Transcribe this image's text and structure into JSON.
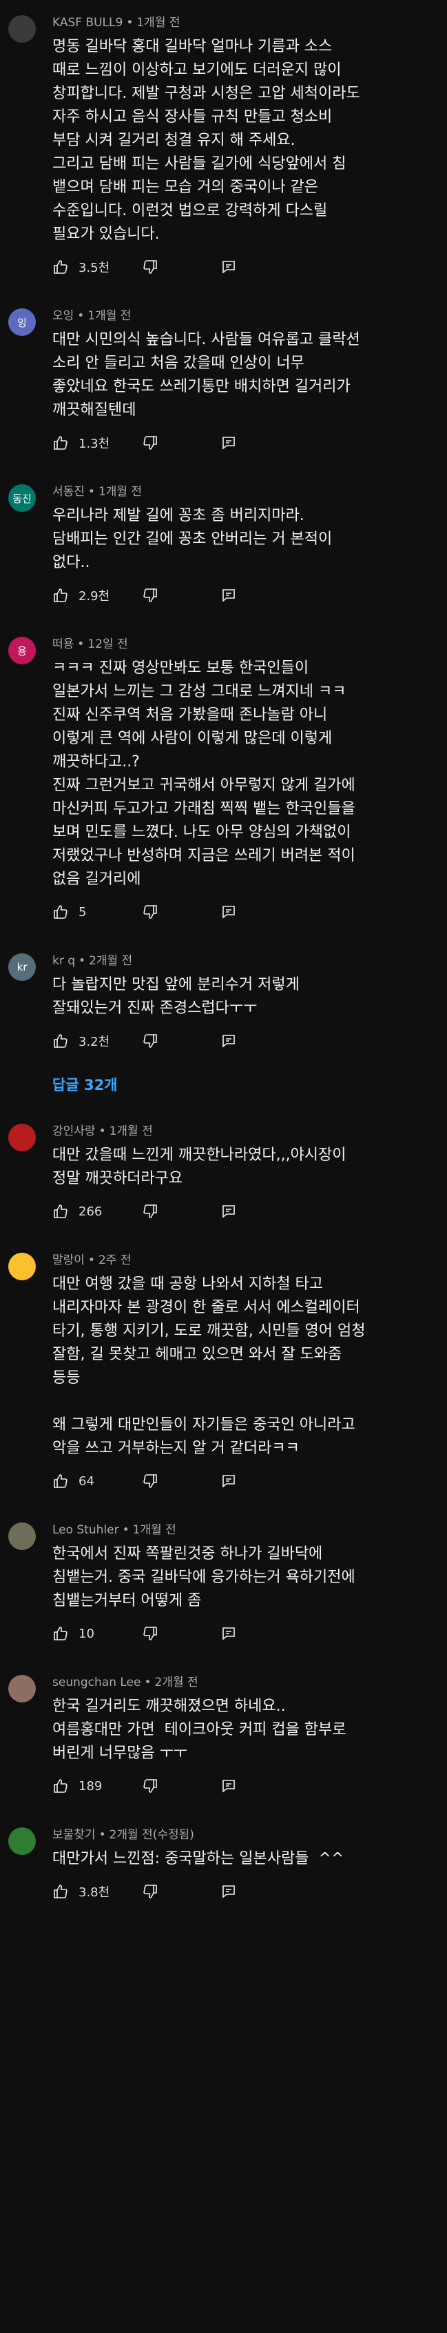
{
  "replies_link": "답글 32개",
  "icons": {
    "like": "thumbs-up-icon",
    "dislike": "thumbs-down-icon",
    "reply": "reply-icon"
  },
  "comments": [
    {
      "author": "KASF BULL9",
      "time": "1개월 전",
      "avatar_text": "",
      "avatar_color": "#3a3a3a",
      "text": "명동 길바닥 홍대 길바닥 얼마나 기름과 소스\n때로 느낌이 이상하고 보기에도 더러운지 많이\n창피합니다. 제발 구청과 시청은 고압 세척이라도\n자주 하시고 음식 장사들 규칙 만들고 청소비\n부담 시켜 길거리 청결 유지 해 주세요.\n그리고 담배 피는 사람들 길가에 식당앞에서 침\n뱉으며 담배 피는 모습 거의 중국이나 같은\n수준입니다. 이런것 법으로 강력하게 다스릴\n필요가 있습니다.",
      "likes": "3.5천"
    },
    {
      "author": "오잉",
      "time": "1개월 전",
      "avatar_text": "잉",
      "avatar_color": "#5c6bc0",
      "text": "대만 시민의식 높습니다. 사람들 여유롭고 클락션\n소리 안 들리고 처음 갔을때 인상이 너무\n좋았네요 한국도 쓰레기통만 배치하면 길거리가\n깨끗해질텐데",
      "likes": "1.3천"
    },
    {
      "author": "서동진",
      "time": "1개월 전",
      "avatar_text": "동진",
      "avatar_color": "#00796b",
      "text": "우리나라 제발 길에 꽁초 좀 버리지마라.\n담배피는 인간 길에 꽁초 안버리는 거 본적이\n없다..",
      "likes": "2.9천"
    },
    {
      "author": "떠용",
      "time": "12일 전",
      "avatar_text": "용",
      "avatar_color": "#c2185b",
      "text": "ㅋㅋㅋ 진짜 영상만봐도 보통 한국인들이\n일본가서 느끼는 그 감성 그대로 느껴지네 ㅋㅋ\n진짜 신주쿠역 처음 가봤을때 존나놀람 아니\n이렇게 큰 역에 사람이 이렇게 많은데 이렇게\n깨끗하다고..?\n진짜 그런거보고 귀국해서 아무렇지 않게 길가에\n마신커피 두고가고 가래침 찍찍 뱉는 한국인들을\n보며 민도를 느꼈다. 나도 아무 양심의 가책없이\n저랬었구나 반성하며 지금은 쓰레기 버려본 적이\n없음 길거리에",
      "likes": "5"
    },
    {
      "author": "kr q",
      "time": "2개월 전",
      "avatar_text": "kr",
      "avatar_color": "#546e7a",
      "text": "다 놀랍지만 맛집 앞에 분리수거 저렇게\n잘돼있는거 진짜 존경스럽다ㅜㅜ",
      "likes": "3.2천"
    },
    {
      "author": "강인사랑",
      "time": "1개월 전",
      "avatar_text": "",
      "avatar_color": "#b71c1c",
      "text": "대만 갔을때 느낀게 깨끗한나라였다,,,야시장이\n정말 깨끗하더라구요",
      "likes": "266"
    },
    {
      "author": "말랑이",
      "time": "2주 전",
      "avatar_text": "",
      "avatar_color": "#fbc02d",
      "text": "대만 여행 갔을 때 공항 나와서 지하철 타고\n내리자마자 본 광경이 한 줄로 서서 에스컬레이터\n타기, 통행 지키기, 도로 깨끗함, 시민들 영어 엄청\n잘함, 길 못찾고 헤매고 있으면 와서 잘 도와줌\n등등\n\n왜 그렇게 대만인들이 자기들은 중국인 아니라고\n악을 쓰고 거부하는지 알 거 같더라ㅋㅋ",
      "likes": "64"
    },
    {
      "author": "Leo Stuhler",
      "time": "1개월 전",
      "avatar_text": "",
      "avatar_color": "#6d6d5a",
      "text": "한국에서 진짜 쪽팔린것중 하나가 길바닥에\n침뱉는거. 중국 길바닥에 응가하는거 욕하기전에\n침뱉는거부터 어떻게 좀",
      "likes": "10"
    },
    {
      "author": "seungchan Lee",
      "time": "2개월 전",
      "avatar_text": "",
      "avatar_color": "#8d6e63",
      "text": "한국 길거리도 깨끗해졌으면 하네요..\n여름홍대만 가면  테이크아웃 커피 컵을 함부로\n버린게 너무많음 ㅜㅜ",
      "likes": "189"
    },
    {
      "author": "보물찾기",
      "time": "2개월 전(수정됨)",
      "avatar_text": "",
      "avatar_color": "#2e7d32",
      "text": "대만가서 느낀점: 중국말하는 일본사람들  ^^",
      "likes": "3.8천"
    }
  ]
}
